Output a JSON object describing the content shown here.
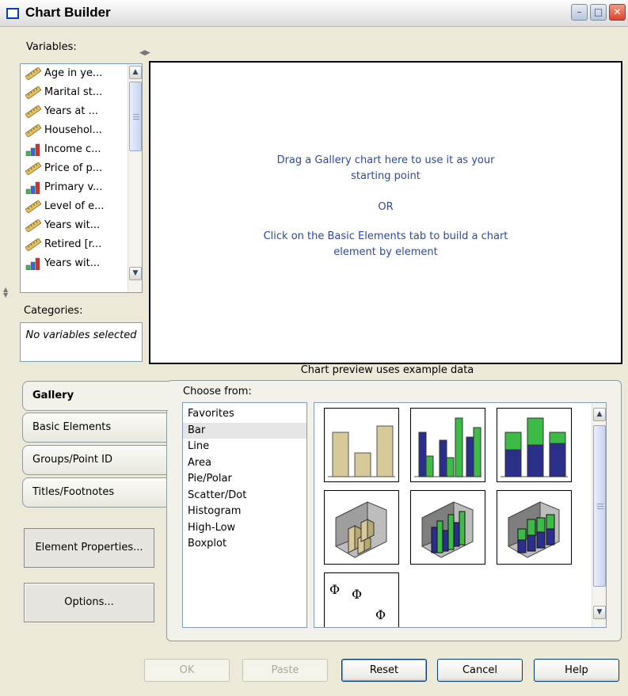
{
  "window": {
    "title": "Chart Builder",
    "controls": [
      "minimize",
      "maximize",
      "close"
    ]
  },
  "variables": {
    "label": "Variables:",
    "items": [
      {
        "label": "Age in ye...",
        "icon": "scale-ruler-icon"
      },
      {
        "label": "Marital st...",
        "icon": "scale-ruler-icon"
      },
      {
        "label": "Years at ...",
        "icon": "scale-ruler-icon"
      },
      {
        "label": "Househol...",
        "icon": "scale-ruler-icon"
      },
      {
        "label": "Income c...",
        "icon": "ordinal-bars-icon"
      },
      {
        "label": "Price of p...",
        "icon": "scale-ruler-icon"
      },
      {
        "label": "Primary v...",
        "icon": "ordinal-bars-icon"
      },
      {
        "label": "Level of e...",
        "icon": "scale-ruler-icon"
      },
      {
        "label": "Years wit...",
        "icon": "scale-ruler-icon"
      },
      {
        "label": "Retired [r...",
        "icon": "scale-ruler-icon"
      },
      {
        "label": "Years wit...",
        "icon": "ordinal-bars-icon"
      }
    ]
  },
  "categories": {
    "label": "Categories:",
    "empty_text": "No variables selected"
  },
  "canvas": {
    "line1": "Drag a Gallery chart here to use it as your",
    "line2": "starting point",
    "or": "OR",
    "line3": "Click on the Basic Elements tab to build a chart",
    "line4": "element by element"
  },
  "preview_note": "Chart preview uses example data",
  "tabs": [
    {
      "label": "Gallery",
      "active": true
    },
    {
      "label": "Basic Elements",
      "active": false
    },
    {
      "label": "Groups/Point ID",
      "active": false
    },
    {
      "label": "Titles/Footnotes",
      "active": false
    }
  ],
  "element_properties_button": "Element Properties...",
  "options_button": "Options...",
  "choose_from": {
    "label": "Choose from:",
    "items": [
      "Favorites",
      "Bar",
      "Line",
      "Area",
      "Pie/Polar",
      "Scatter/Dot",
      "Histogram",
      "High-Low",
      "Boxplot"
    ],
    "selected": "Bar"
  },
  "gallery_thumbnails": [
    {
      "name": "simple-bar-thumb"
    },
    {
      "name": "clustered-bar-thumb"
    },
    {
      "name": "stacked-bar-thumb"
    },
    {
      "name": "3d-simple-bar-thumb"
    },
    {
      "name": "3d-clustered-bar-thumb"
    },
    {
      "name": "3d-stacked-bar-thumb"
    },
    {
      "name": "error-bar-thumb"
    }
  ],
  "colors": {
    "bar_tan": "#d8c99b",
    "bar_navy": "#2b2f8a",
    "bar_green": "#3dbb47",
    "canvas_text": "#2a4aa8"
  },
  "footer": {
    "ok": "OK",
    "paste": "Paste",
    "reset": "Reset",
    "cancel": "Cancel",
    "help": "Help"
  }
}
